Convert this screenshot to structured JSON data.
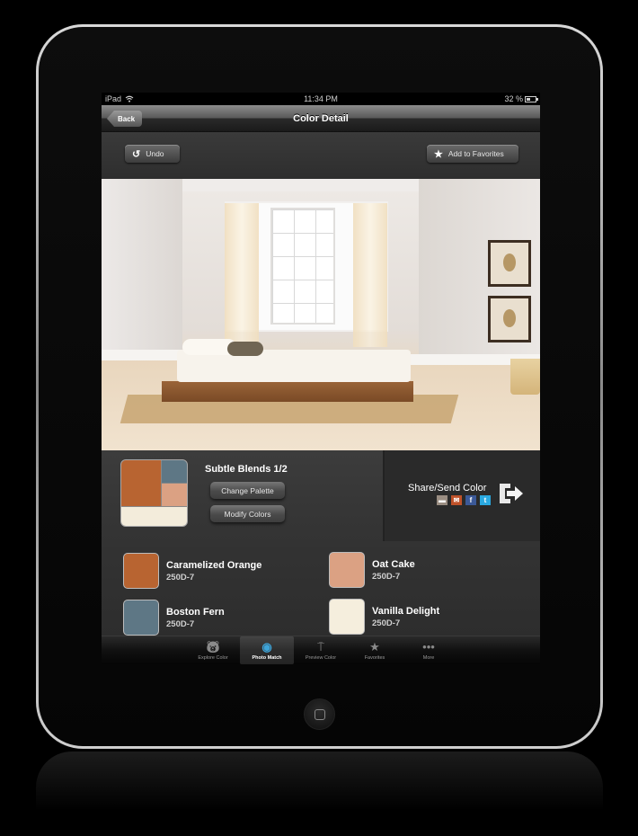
{
  "status_bar": {
    "device": "iPad",
    "time": "11:34 PM",
    "battery": "32 %",
    "battery_level": 0.32
  },
  "nav": {
    "back_label": "Back",
    "title": "Color Detail"
  },
  "toolbar": {
    "undo_label": "Undo",
    "add_favorites_label": "Add to Favorites"
  },
  "palette": {
    "title": "Subtle Blends 1/2",
    "change_palette_label": "Change Palette",
    "modify_colors_label": "Modify Colors",
    "swatch_colors": [
      "#b86431",
      "#5e7785",
      "#dba183",
      "#f3ecdb"
    ]
  },
  "share": {
    "label": "Share/Send Color",
    "icons": [
      "message-icon",
      "email-icon",
      "facebook-icon",
      "twitter-icon"
    ]
  },
  "colors": [
    {
      "name": "Caramelized Orange",
      "code": "250D-7",
      "hex": "#b86431"
    },
    {
      "name": "Oat Cake",
      "code": "250D-7",
      "hex": "#dba183"
    },
    {
      "name": "Boston Fern",
      "code": "250D-7",
      "hex": "#5e7785"
    },
    {
      "name": "Vanilla Delight",
      "code": "250D-7",
      "hex": "#f5eedd"
    }
  ],
  "tabs": [
    {
      "label": "Explore Color",
      "icon": "bear-icon",
      "active": false
    },
    {
      "label": "Photo Match",
      "icon": "camera-icon",
      "active": true
    },
    {
      "label": "Preview Color",
      "icon": "paint-roller-icon",
      "active": false
    },
    {
      "label": "Favorites",
      "icon": "star-icon",
      "active": false
    },
    {
      "label": "More",
      "icon": "more-dots-icon",
      "active": false
    }
  ]
}
